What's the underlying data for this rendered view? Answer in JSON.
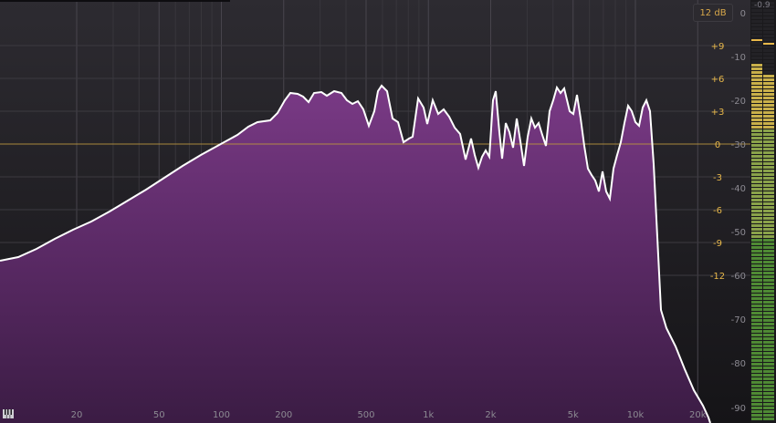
{
  "range_button": {
    "label": "12 dB"
  },
  "meter": {
    "peak_readout": "-0.9"
  },
  "freq_axis": {
    "labels": [
      "20",
      "50",
      "100",
      "200",
      "500",
      "1k",
      "2k",
      "5k",
      "10k",
      "20k"
    ],
    "values": [
      20,
      50,
      100,
      200,
      500,
      1000,
      2000,
      5000,
      10000,
      20000
    ]
  },
  "gain_axis": {
    "labels": [
      "+9",
      "+6",
      "+3",
      "0",
      "-3",
      "-6",
      "-9",
      "-12"
    ]
  },
  "level_axis": {
    "labels": [
      "0",
      "-10",
      "-20",
      "-30",
      "-40",
      "-50",
      "-60",
      "-70",
      "-80",
      "-90"
    ]
  },
  "colors": {
    "accent": "#e8b84a",
    "fill": "#5c2a66",
    "curve": "#ffffff"
  },
  "icons": {
    "piano": "piano-keys-icon"
  }
}
